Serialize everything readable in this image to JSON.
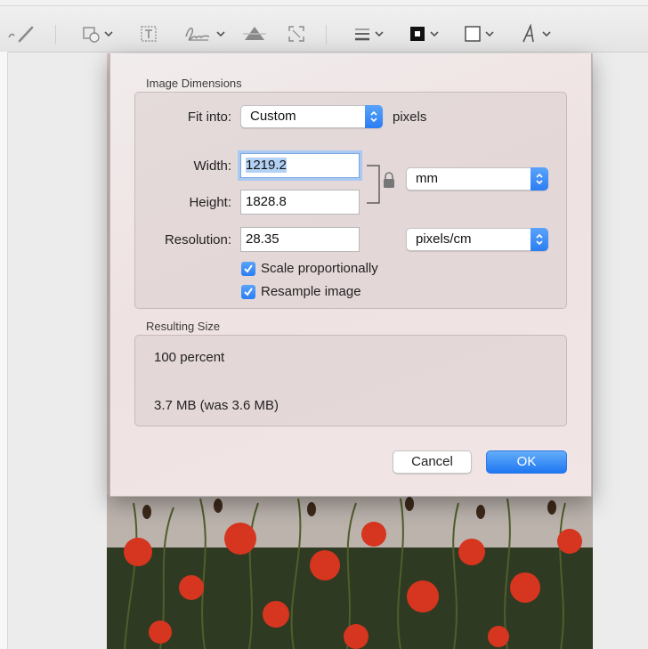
{
  "toolbar": {
    "tools": [
      "sketch-icon",
      "shapes-icon",
      "text-icon",
      "sign-icon",
      "adjust-color-icon",
      "adjust-size-icon",
      "shape-style-icon",
      "border-color-icon",
      "fill-color-icon",
      "text-style-icon"
    ]
  },
  "dialog": {
    "image_dimensions_title": "Image Dimensions",
    "fit_into_label": "Fit into:",
    "fit_into_value": "Custom",
    "fit_into_unit": "pixels",
    "width_label": "Width:",
    "width_value": "1219.2",
    "height_label": "Height:",
    "height_value": "1828.8",
    "dimension_unit": "mm",
    "resolution_label": "Resolution:",
    "resolution_value": "28.35",
    "resolution_unit": "pixels/cm",
    "scale_proportionally_label": "Scale proportionally",
    "scale_proportionally_checked": true,
    "resample_label": "Resample image",
    "resample_checked": true,
    "resulting_size_title": "Resulting Size",
    "result_percent": "100 percent",
    "result_filesize": "3.7 MB (was 3.6 MB)",
    "cancel_label": "Cancel",
    "ok_label": "OK"
  },
  "colors": {
    "accent": "#2b7df3",
    "toolbar_icon": "#8a8a8a"
  }
}
